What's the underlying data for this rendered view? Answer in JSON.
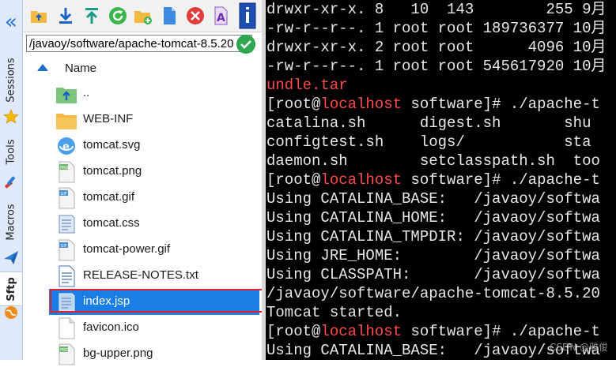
{
  "sidebar": {
    "tabs": [
      {
        "label": "Sessions"
      },
      {
        "label": "Tools"
      },
      {
        "label": "Macros"
      },
      {
        "label": "Sftp"
      }
    ]
  },
  "toolbar": {
    "buttons": [
      "parent-folder",
      "download",
      "upload",
      "refresh",
      "new-folder",
      "new-file",
      "delete",
      "text-mode",
      "settings"
    ]
  },
  "path": {
    "value": "/javaoy/software/apache-tomcat-8.5.20"
  },
  "filelist": {
    "header": "Name",
    "items": [
      {
        "name": "..",
        "icon": "parent-folder-icon"
      },
      {
        "name": "WEB-INF",
        "icon": "folder-icon"
      },
      {
        "name": "tomcat.svg",
        "icon": "svg-file-icon"
      },
      {
        "name": "tomcat.png",
        "icon": "png-file-icon"
      },
      {
        "name": "tomcat.gif",
        "icon": "gif-file-icon"
      },
      {
        "name": "tomcat.css",
        "icon": "css-file-icon"
      },
      {
        "name": "tomcat-power.gif",
        "icon": "gif-file-icon"
      },
      {
        "name": "RELEASE-NOTES.txt",
        "icon": "text-file-icon"
      },
      {
        "name": "index.jsp",
        "icon": "jsp-file-icon",
        "selected": true
      },
      {
        "name": "favicon.ico",
        "icon": "ico-file-icon"
      },
      {
        "name": "bg-upper.png",
        "icon": "png-file-icon"
      }
    ]
  },
  "terminal": {
    "lines": [
      {
        "segments": [
          {
            "t": "drwxr-xr-x. 8   10  143        255 9月"
          }
        ]
      },
      {
        "segments": [
          {
            "t": "-rw-r--r--. 1 root root 189736377 10月"
          }
        ]
      },
      {
        "segments": [
          {
            "t": "drwxr-xr-x. 2 root root      4096 10月"
          }
        ]
      },
      {
        "segments": [
          {
            "t": "-rw-r--r--. 1 root root 545617920 10月"
          }
        ]
      },
      {
        "segments": [
          {
            "t": "undle.tar",
            "c": "red"
          }
        ]
      },
      {
        "segments": [
          {
            "t": "[root@"
          },
          {
            "t": "localhost",
            "c": "red"
          },
          {
            "t": " software]# ./apache-t"
          }
        ]
      },
      {
        "segments": [
          {
            "t": "catalina.sh      digest.sh       shu"
          }
        ]
      },
      {
        "segments": [
          {
            "t": "configtest.sh    logs/           sta"
          }
        ]
      },
      {
        "segments": [
          {
            "t": "daemon.sh        setclasspath.sh  too"
          }
        ]
      },
      {
        "segments": [
          {
            "t": "[root@"
          },
          {
            "t": "localhost",
            "c": "red"
          },
          {
            "t": " software]# ./apache-t"
          }
        ]
      },
      {
        "segments": [
          {
            "t": "Using CATALINA_BASE:   /javaoy/softwa"
          }
        ]
      },
      {
        "segments": [
          {
            "t": "Using CATALINA_HOME:   /javaoy/softwa"
          }
        ]
      },
      {
        "segments": [
          {
            "t": "Using CATALINA_TMPDIR: /javaoy/softwa"
          }
        ]
      },
      {
        "segments": [
          {
            "t": "Using JRE_HOME:        /javaoy/softwa"
          }
        ]
      },
      {
        "segments": [
          {
            "t": "Using CLASSPATH:       /javaoy/softwa"
          }
        ]
      },
      {
        "segments": [
          {
            "t": "/javaoy/software/apache-tomcat-8.5.20"
          }
        ]
      },
      {
        "segments": [
          {
            "t": "Tomcat started."
          }
        ]
      },
      {
        "segments": [
          {
            "t": "[root@"
          },
          {
            "t": "localhost",
            "c": "red"
          },
          {
            "t": " software]# ./apache-t"
          }
        ]
      },
      {
        "segments": [
          {
            "t": "Using CATALINA_BASE:   /javaoy/softwa"
          }
        ]
      }
    ],
    "watermark": "CSDN @雅俊"
  }
}
